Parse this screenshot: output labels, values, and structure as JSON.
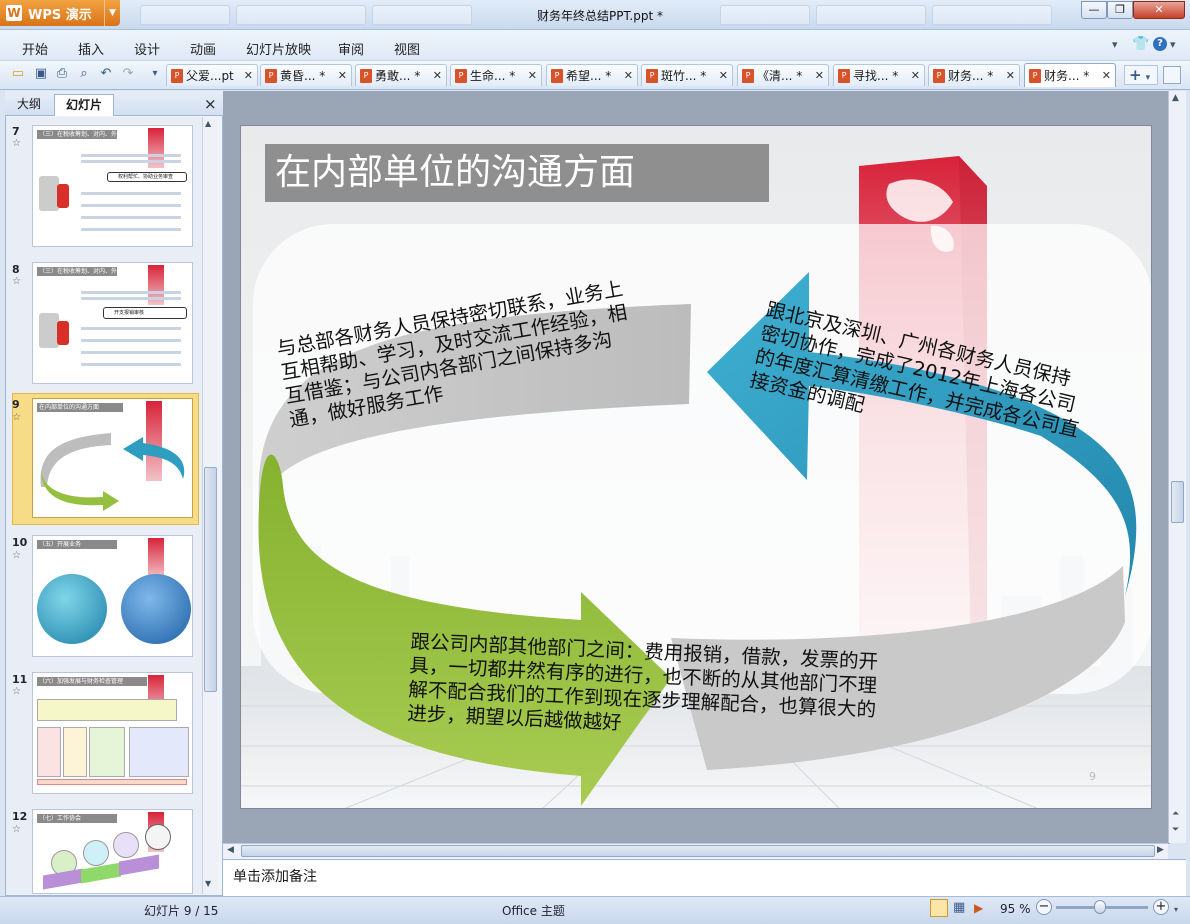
{
  "app": {
    "name": "WPS 演示",
    "window_title": "财务年终总结PPT.ppt *"
  },
  "window_controls": {
    "minimize": "—",
    "restore": "❐",
    "close": "✕"
  },
  "menu": [
    "开始",
    "插入",
    "设计",
    "动画",
    "幻灯片放映",
    "审阅",
    "视图"
  ],
  "toolbar_icons": [
    "open-icon",
    "save-icon",
    "print-icon",
    "print-preview-icon",
    "undo-icon",
    "redo-icon",
    "customize-icon"
  ],
  "doc_tabs": [
    {
      "label": "父爱...pt"
    },
    {
      "label": "黄昏... *"
    },
    {
      "label": "勇敢... *"
    },
    {
      "label": "生命... *"
    },
    {
      "label": "希望... *"
    },
    {
      "label": "斑竹... *"
    },
    {
      "label": "《清... *"
    },
    {
      "label": "寻找... *"
    },
    {
      "label": "财务... *"
    },
    {
      "label": "财务... *",
      "active": true
    }
  ],
  "panel": {
    "tab_outline": "大纲",
    "tab_slides": "幻灯片",
    "close": "×"
  },
  "thumbnails": [
    {
      "num": "7",
      "header": "（三）在税收筹划、对内、外关系方面",
      "highlight": "权利帮忙、协助业务审查"
    },
    {
      "num": "8",
      "header": "（三）在税收筹划、对内、外关系方面",
      "highlight": "开支报销审核"
    },
    {
      "num": "9",
      "header": "在内部单位的沟通方面",
      "selected": true
    },
    {
      "num": "10",
      "header": "（五）开展业务"
    },
    {
      "num": "11",
      "header": "（六）加强发展与财务检查管理"
    },
    {
      "num": "12",
      "header": "（七）工作协会"
    }
  ],
  "slide": {
    "title": "在内部单位的沟通方面",
    "gray_text": [
      "与总部各财务人员保持密切联系，业务上",
      "互相帮助、学习，及时交流工作经验，相",
      "互借鉴；与公司内各部门之间保持多沟",
      "通，做好服务工作"
    ],
    "blue_text": [
      "跟北京及深圳、广州各财务人员保持",
      "密切协作，完成了2012年上海各公司",
      "的年度汇算清缴工作，并完成各公司直",
      "接资金的调配"
    ],
    "green_text": [
      "跟公司内部其他部门之间：费用报销，借款，发票的开",
      "具，一切都井然有序的进行，也不断的从其他部门不理",
      "解不配合我们的工作到现在逐步理解配合，也算很大的",
      "进步，期望以后越做越好"
    ],
    "page_number": "9"
  },
  "notes_placeholder": "单击添加备注",
  "status": {
    "slide_counter": "幻灯片 9 / 15",
    "theme": "Office 主题",
    "zoom": "95 %"
  },
  "colors": {
    "accent": "#d9731a",
    "blue_arrow": "#2f9dbf",
    "green_arrow": "#95bf3e",
    "gray_arrow": "#bdbdbd",
    "red_building": "#d8233a"
  }
}
